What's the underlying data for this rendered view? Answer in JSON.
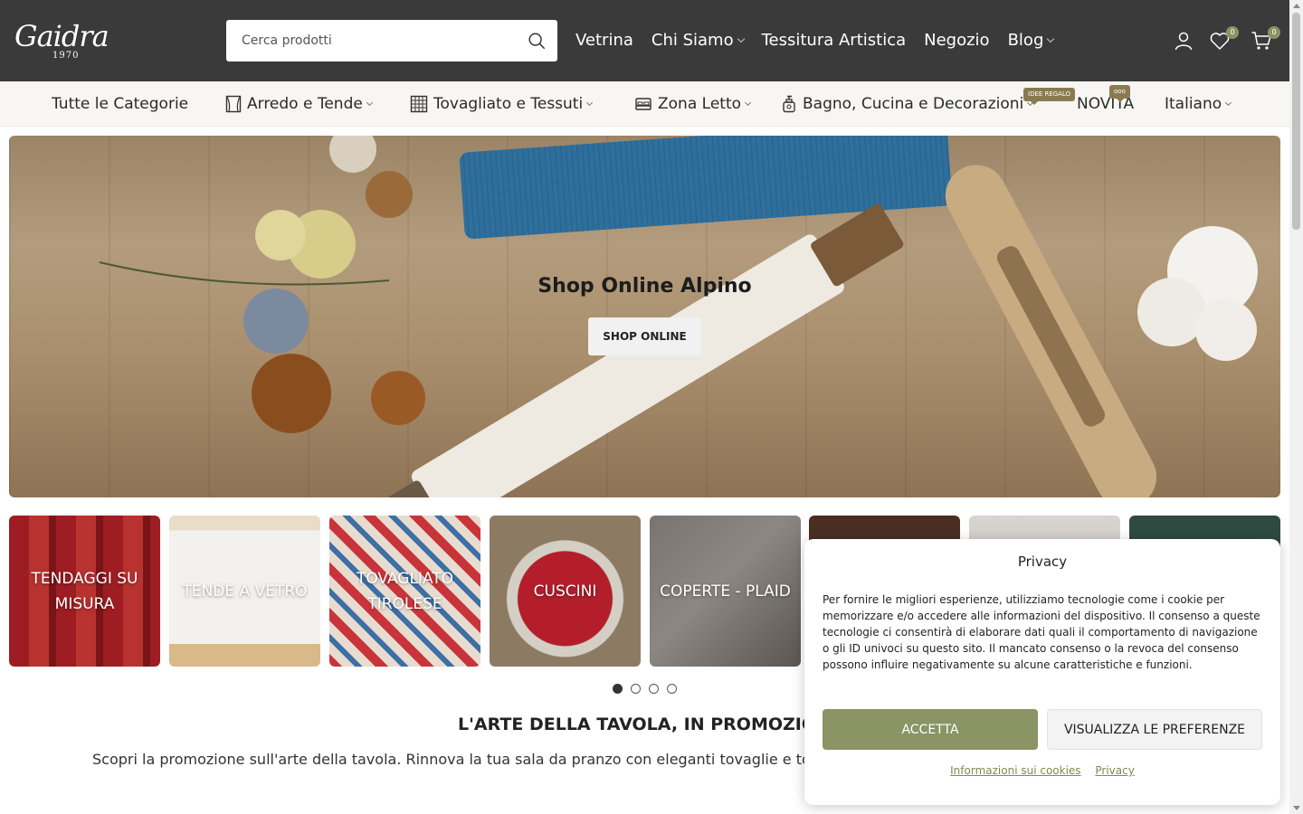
{
  "header": {
    "logo_text": "Gaidra",
    "logo_year": "1970",
    "search_placeholder": "Cerca prodotti",
    "nav": [
      "Vetrina",
      "Chi Siamo",
      "Tessitura Artistica",
      "Negozio",
      "Blog"
    ],
    "wishlist_count": "0",
    "cart_count": "0"
  },
  "categories": {
    "all": "Tutte le Categorie",
    "items": [
      "Arredo e Tende",
      "Tovagliato e Tessuti",
      "Zona Letto",
      "Bagno, Cucina e Decorazioni",
      "NOVITÀ",
      "Italiano"
    ],
    "tag_gift": "IDEE REGALO",
    "tag_new": "ooo"
  },
  "hero": {
    "title": "Shop Online Alpino",
    "button": "SHOP ONLINE"
  },
  "tiles": [
    {
      "label": "TENDAGGI SU MISURA"
    },
    {
      "label": "TENDE A VETRO"
    },
    {
      "label": "TOVAGLIATO TIROLESE"
    },
    {
      "label": "CUSCINI"
    },
    {
      "label": "COPERTE - PLAID"
    },
    {
      "label": ""
    },
    {
      "label": ""
    },
    {
      "label": ""
    }
  ],
  "carousel": {
    "pages": 4,
    "active": 1
  },
  "promo": {
    "title": "L'ARTE DELLA TAVOLA, IN PROMOZIO",
    "text": "Scopri la promozione sull'arte della tavola. Rinnova la tua sala da pranzo con eleganti tovaglie e to"
  },
  "privacy": {
    "title": "Privacy",
    "text": "Per fornire le migliori esperienze, utilizziamo tecnologie come i cookie per memorizzare e/o accedere alle informazioni del dispositivo. Il consenso a queste tecnologie ci consentirà di elaborare dati quali il comportamento di navigazione o gli ID univoci su questo sito. Il mancato consenso o la revoca del consenso possono influire negativamente su alcune caratteristiche e funzioni.",
    "accept": "ACCETTA",
    "preferences": "VISUALIZZA LE PREFERENZE",
    "link_cookies": "Informazioni sui cookies",
    "link_privacy": "Privacy"
  },
  "colors": {
    "header_bg": "#3a3a3a",
    "accent": "#8a9464",
    "catbar_bg": "#f7f6f2"
  }
}
